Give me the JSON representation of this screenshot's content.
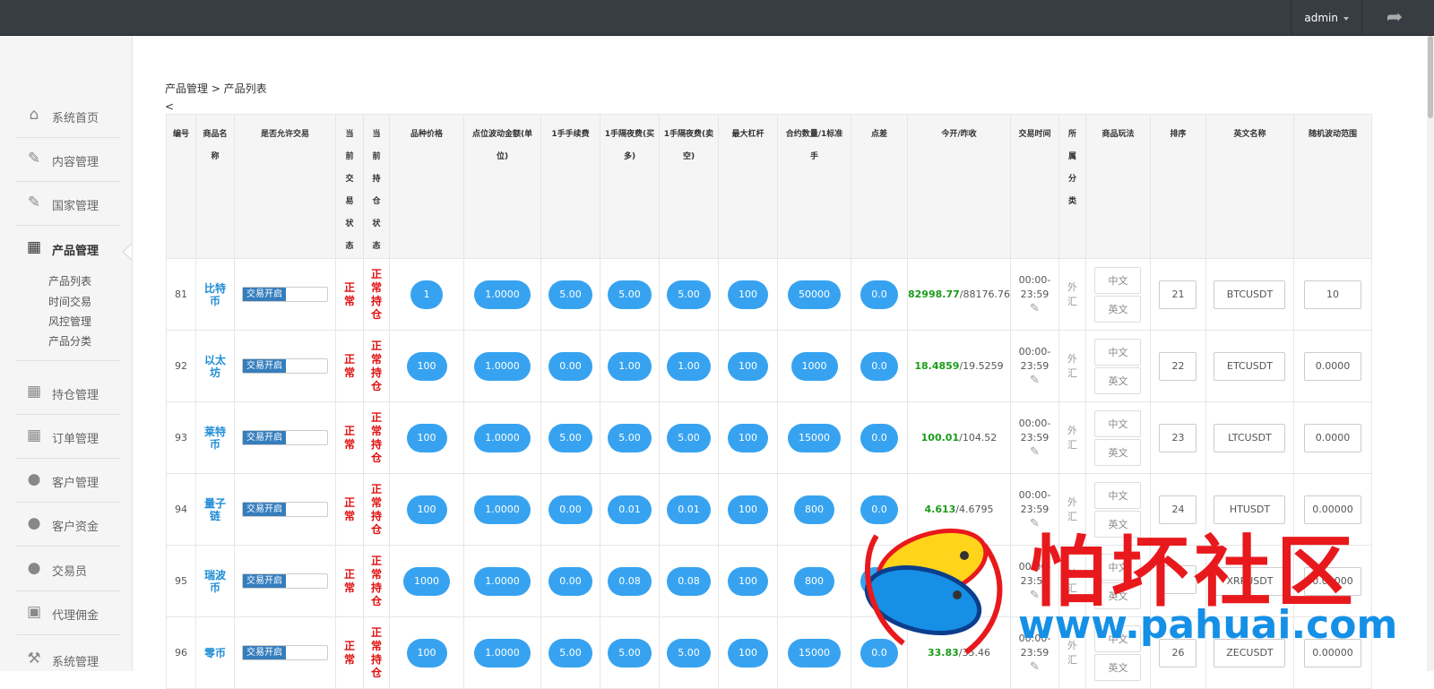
{
  "header": {
    "user": "admin",
    "logout_icon": "share-arrow-icon"
  },
  "sidebar": {
    "items": [
      {
        "label": "系统首页",
        "icon": "home-icon"
      },
      {
        "label": "内容管理",
        "icon": "edit-icon"
      },
      {
        "label": "国家管理",
        "icon": "edit-icon"
      },
      {
        "label": "产品管理",
        "icon": "calendar-icon"
      },
      {
        "label": "持仓管理",
        "icon": "grid-icon"
      },
      {
        "label": "订单管理",
        "icon": "grid-icon"
      },
      {
        "label": "客户管理",
        "icon": "users-icon"
      },
      {
        "label": "客户资金",
        "icon": "users-icon"
      },
      {
        "label": "交易员",
        "icon": "users-icon"
      },
      {
        "label": "代理佣金",
        "icon": "picture-icon"
      },
      {
        "label": "系统管理",
        "icon": "wrench-icon"
      }
    ],
    "subitems": [
      "产品列表",
      "时间交易",
      "风控管理",
      "产品分类"
    ]
  },
  "page": {
    "breadcrumb": "产品管理 > 产品列表",
    "back": "<"
  },
  "table": {
    "headers": [
      "编号",
      "商品名称",
      "是否允许交易",
      "当前交易状态",
      "当前持仓状态",
      "品种价格",
      "点位波动金额(单位)",
      "1手手续费",
      "1手隔夜费(买多)",
      "1手隔夜费(卖空)",
      "最大杠杆",
      "合约数量/1标准手",
      "点差",
      "今开/昨收",
      "交易时间",
      "所属分类",
      "商品玩法",
      "排序",
      "英文名称",
      "随机波动范围"
    ],
    "toggle_label": "交易开启",
    "status_trade": "正常",
    "status_position": "正常持仓",
    "category": "外汇",
    "btn_cn": "中文",
    "btn_en": "英文",
    "rows": [
      {
        "id": "81",
        "name": "比特币",
        "price": "1",
        "move": "1.0000",
        "fee": "5.00",
        "buy": "5.00",
        "sell": "5.00",
        "lev": "100",
        "qty": "50000",
        "spread": "0.0",
        "open": "82998.77",
        "close": "/88176.76",
        "time_a": "00:00-",
        "time_b": "23:59",
        "sort": "21",
        "en": "BTCUSDT",
        "range": "10"
      },
      {
        "id": "92",
        "name": "以太坊",
        "price": "100",
        "move": "1.0000",
        "fee": "0.00",
        "buy": "1.00",
        "sell": "1.00",
        "lev": "100",
        "qty": "1000",
        "spread": "0.0",
        "open": "18.4859",
        "close": "/19.5259",
        "time_a": "00:00-",
        "time_b": "23:59",
        "sort": "22",
        "en": "ETCUSDT",
        "range": "0.0000"
      },
      {
        "id": "93",
        "name": "莱特币",
        "price": "100",
        "move": "1.0000",
        "fee": "5.00",
        "buy": "5.00",
        "sell": "5.00",
        "lev": "100",
        "qty": "15000",
        "spread": "0.0",
        "open": "100.01",
        "close": "/104.52",
        "time_a": "00:00-",
        "time_b": "23:59",
        "sort": "23",
        "en": "LTCUSDT",
        "range": "0.0000"
      },
      {
        "id": "94",
        "name": "量子链",
        "price": "100",
        "move": "1.0000",
        "fee": "0.00",
        "buy": "0.01",
        "sell": "0.01",
        "lev": "100",
        "qty": "800",
        "spread": "0.0",
        "open": "4.613",
        "close": "/4.6795",
        "time_a": "00:00-",
        "time_b": "23:59",
        "sort": "24",
        "en": "HTUSDT",
        "range": "0.00000"
      },
      {
        "id": "95",
        "name": "瑞波币",
        "price": "1000",
        "move": "1.0000",
        "fee": "0.00",
        "buy": "0.08",
        "sell": "0.08",
        "lev": "100",
        "qty": "800",
        "spread": "0.0",
        "open": "",
        "close": "",
        "time_a": "00:00-",
        "time_b": "23:59",
        "sort": "",
        "en": "XRPUSDT",
        "range": "0.00000"
      },
      {
        "id": "96",
        "name": "零币",
        "price": "100",
        "move": "1.0000",
        "fee": "5.00",
        "buy": "5.00",
        "sell": "5.00",
        "lev": "100",
        "qty": "15000",
        "spread": "0.0",
        "open": "33.83",
        "close": "/35.46",
        "time_a": "00:00-",
        "time_b": "23:59",
        "sort": "26",
        "en": "ZECUSDT",
        "range": "0.00000"
      }
    ]
  },
  "watermark": {
    "title": "怕坏社区",
    "url": "www.pahuai.com"
  }
}
